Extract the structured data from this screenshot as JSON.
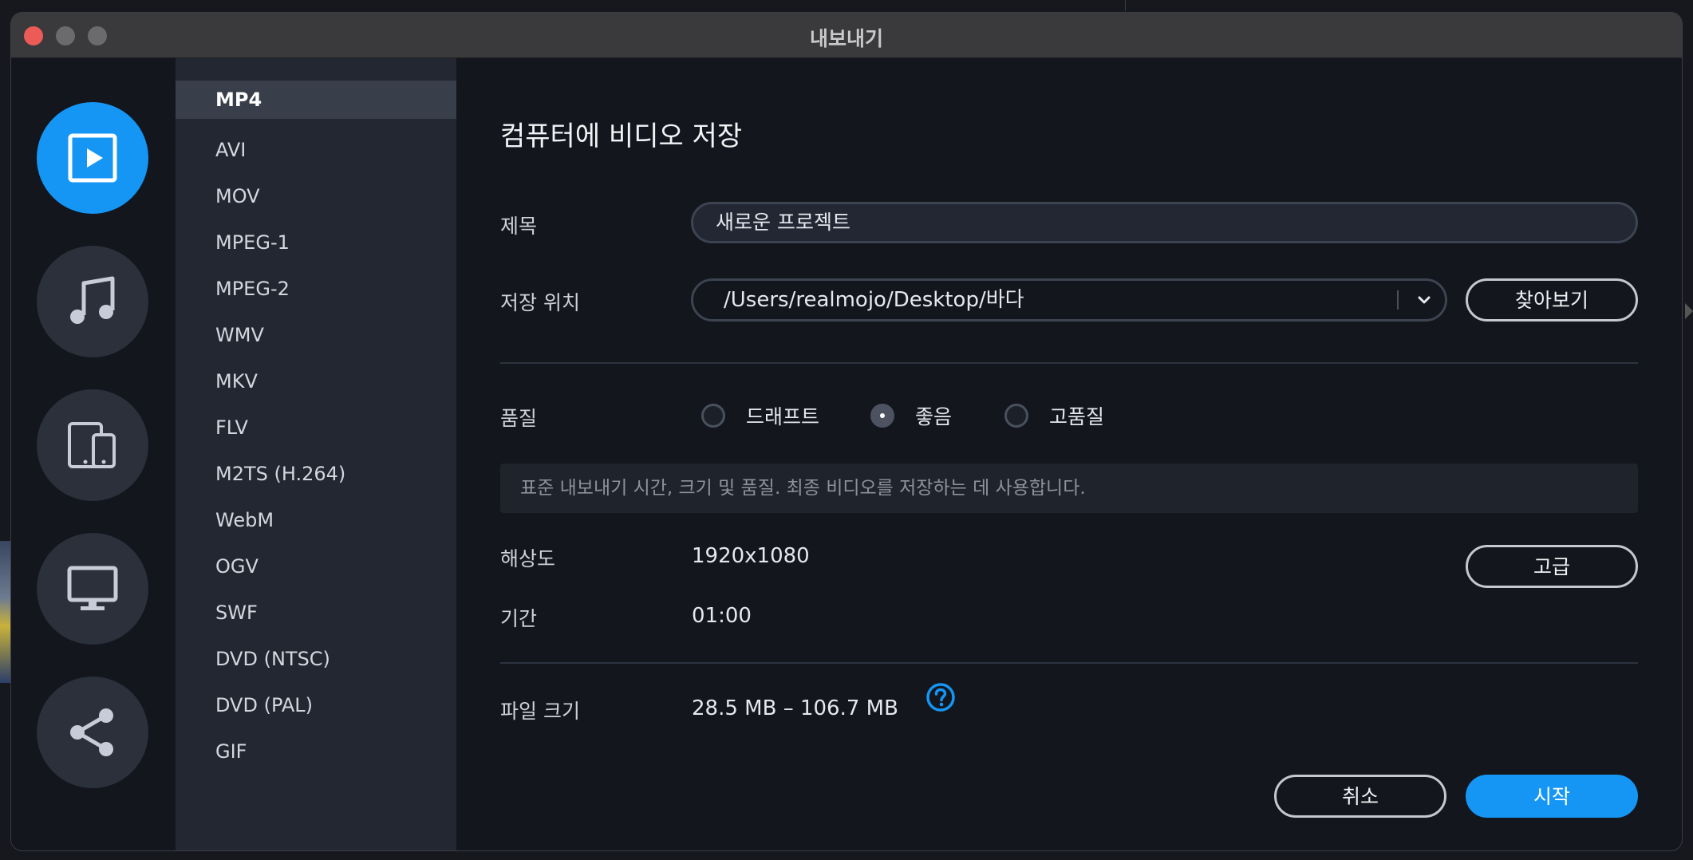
{
  "window": {
    "title": "내보내기"
  },
  "rail": {
    "items": [
      {
        "id": "video",
        "icon": "play-screen-icon",
        "active": true
      },
      {
        "id": "audio",
        "icon": "music-note-icon",
        "active": false
      },
      {
        "id": "devices",
        "icon": "devices-icon",
        "active": false
      },
      {
        "id": "tv",
        "icon": "monitor-icon",
        "active": false
      },
      {
        "id": "share",
        "icon": "share-icon",
        "active": false
      }
    ]
  },
  "formats": {
    "selected": "MP4",
    "items": [
      "MP4",
      "AVI",
      "MOV",
      "MPEG-1",
      "MPEG-2",
      "WMV",
      "MKV",
      "FLV",
      "M2TS (H.264)",
      "WebM",
      "OGV",
      "SWF",
      "DVD (NTSC)",
      "DVD (PAL)",
      "GIF"
    ]
  },
  "main": {
    "section_title": "컴퓨터에 비디오 저장",
    "title_label": "제목",
    "title_value": "새로운 프로젝트",
    "location_label": "저장 위치",
    "location_value": "/Users/realmojo/Desktop/바다",
    "browse_label": "찾아보기",
    "quality_label": "품질",
    "quality_options": [
      {
        "label": "드래프트",
        "checked": false
      },
      {
        "label": "좋음",
        "checked": true
      },
      {
        "label": "고품질",
        "checked": false
      }
    ],
    "quality_description": "표준 내보내기 시간, 크기 및 품질. 최종 비디오를 저장하는 데 사용합니다.",
    "resolution_label": "해상도",
    "resolution_value": "1920x1080",
    "advanced_label": "고급",
    "duration_label": "기간",
    "duration_value": "01:00",
    "filesize_label": "파일 크기",
    "filesize_value": "28.5 MB – 106.7 MB",
    "cancel_label": "취소",
    "start_label": "시작"
  },
  "colors": {
    "accent": "#1596f5",
    "window_bg": "#13161c",
    "list_bg": "#222732",
    "list_selected_bg": "#393e4b",
    "titlebar_bg": "#3a3a3c",
    "close_button": "#ec5b56"
  }
}
